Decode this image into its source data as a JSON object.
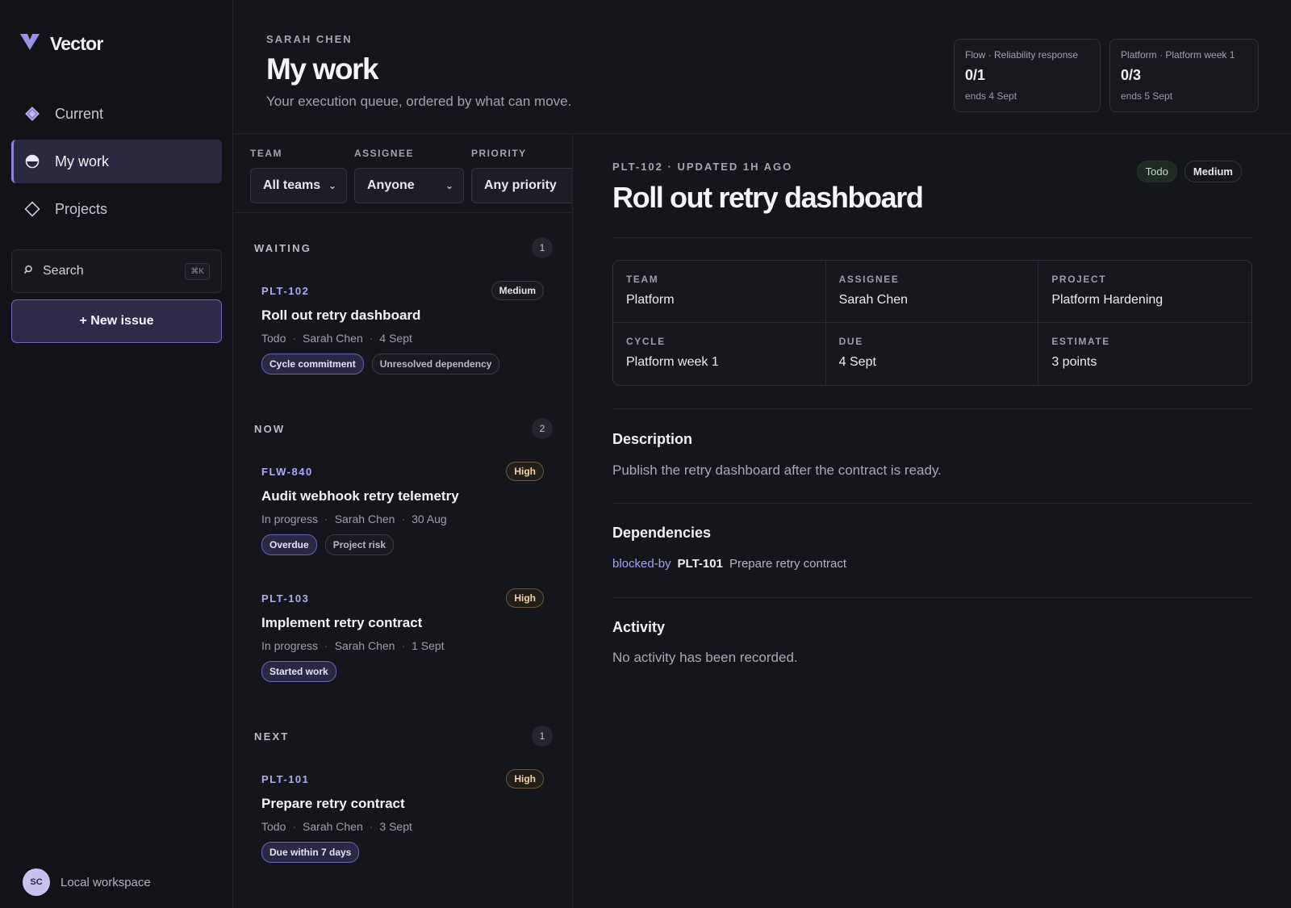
{
  "app": {
    "name": "Vector",
    "accent": "#8f86d9"
  },
  "sidebar": {
    "nav": [
      {
        "label": "Current",
        "icon": "diamond-filled-icon",
        "active": false
      },
      {
        "label": "My work",
        "icon": "half-circle-icon",
        "active": true
      },
      {
        "label": "Projects",
        "icon": "diamond-outline-icon",
        "active": false
      }
    ],
    "search": {
      "label": "Search",
      "shortcut": "⌘K"
    },
    "new_issue": "+ New issue",
    "workspace": {
      "initials": "SC",
      "label": "Local workspace"
    }
  },
  "header": {
    "kicker": "SARAH CHEN",
    "title": "My work",
    "subtitle": "Your execution queue, ordered by what can move.",
    "cycles": [
      {
        "label": "Flow · Reliability response",
        "value": "0/1",
        "ends": "ends 4 Sept"
      },
      {
        "label": "Platform · Platform week 1",
        "value": "0/3",
        "ends": "ends 5 Sept"
      }
    ]
  },
  "filters": {
    "team": {
      "label": "TEAM",
      "value": "All teams"
    },
    "assignee": {
      "label": "ASSIGNEE",
      "value": "Anyone"
    },
    "priority": {
      "label": "PRIORITY",
      "value": "Any priority"
    }
  },
  "groups": [
    {
      "label": "WAITING",
      "count": "1",
      "issues": [
        {
          "id": "PLT-102",
          "priority": "Medium",
          "title": "Roll out retry dashboard",
          "status": "Todo",
          "assignee": "Sarah Chen",
          "due": "4 Sept",
          "tags": [
            "Cycle commitment",
            "Unresolved dependency"
          ]
        }
      ]
    },
    {
      "label": "NOW",
      "count": "2",
      "issues": [
        {
          "id": "FLW-840",
          "priority": "High",
          "title": "Audit webhook retry telemetry",
          "status": "In progress",
          "assignee": "Sarah Chen",
          "due": "30 Aug",
          "tags": [
            "Overdue",
            "Project risk"
          ]
        },
        {
          "id": "PLT-103",
          "priority": "High",
          "title": "Implement retry contract",
          "status": "In progress",
          "assignee": "Sarah Chen",
          "due": "1 Sept",
          "tags": [
            "Started work"
          ]
        }
      ]
    },
    {
      "label": "NEXT",
      "count": "1",
      "issues": [
        {
          "id": "PLT-101",
          "priority": "High",
          "title": "Prepare retry contract",
          "status": "Todo",
          "assignee": "Sarah Chen",
          "due": "3 Sept",
          "tags": [
            "Due within 7 days"
          ]
        }
      ]
    }
  ],
  "detail": {
    "kicker": "PLT-102 · UPDATED 1H AGO",
    "title": "Roll out retry dashboard",
    "status": "Todo",
    "priority": "Medium",
    "properties": [
      {
        "label": "TEAM",
        "value": "Platform"
      },
      {
        "label": "ASSIGNEE",
        "value": "Sarah Chen"
      },
      {
        "label": "PROJECT",
        "value": "Platform Hardening"
      },
      {
        "label": "CYCLE",
        "value": "Platform week 1"
      },
      {
        "label": "DUE",
        "value": "4 Sept"
      },
      {
        "label": "ESTIMATE",
        "value": "3 points"
      }
    ],
    "description": {
      "title": "Description",
      "text": "Publish the retry dashboard after the contract is ready."
    },
    "dependencies": {
      "title": "Dependencies",
      "relation": "blocked-by",
      "id": "PLT-101",
      "item_title": "Prepare retry contract"
    },
    "activity": {
      "title": "Activity",
      "text": "No activity has been recorded."
    }
  }
}
